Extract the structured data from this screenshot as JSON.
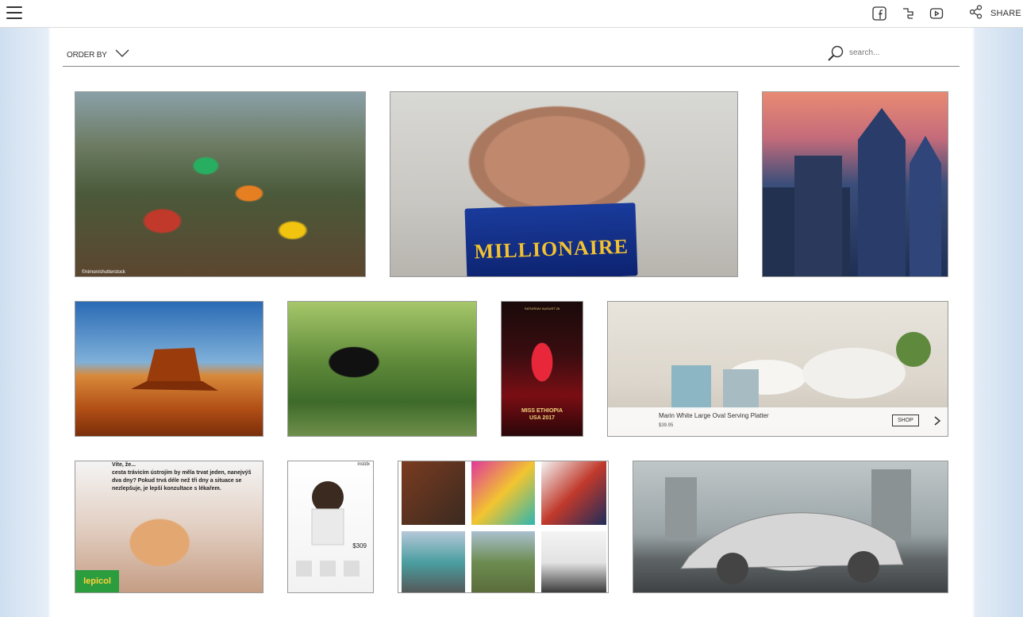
{
  "header": {
    "menu_icon": "hamburger-menu-icon",
    "social": [
      {
        "name": "facebook-icon",
        "label": "Facebook"
      },
      {
        "name": "twitter-icon",
        "label": "Twitter"
      },
      {
        "name": "youtube-icon",
        "label": "YouTube"
      }
    ],
    "share_label": "SHARE",
    "share_icon": "share-icon"
  },
  "toolbar": {
    "order_by_label": "ORDER BY",
    "search_placeholder": "search..."
  },
  "tiles": {
    "millionaire": {
      "text": "MILLIONAIRE"
    },
    "market": {
      "credit": "©nimon/shutterstock"
    },
    "poster": {
      "title": "MISS ETHIOPIA",
      "subtitle": "USA 2017",
      "top": "SATURDAY AUGUST 26"
    },
    "dishes": {
      "product_name": "Marin White Large Oval Serving Platter",
      "price": "$39.95",
      "shop_label": "SHOP"
    },
    "lepicol": {
      "text": "Víte, že...\ncesta trávicím ústrojím by měla trvat jeden, nanejvýš dva dny? Pokud trvá déle než tři dny a situace se nezlepšuje, je lepší konzultace s lékařem.",
      "logo": "lepicol"
    },
    "magazine": {
      "brand": "instdx",
      "price": "$309"
    }
  },
  "colors": {
    "accent": "#333333",
    "divider": "#888888",
    "side_gradient": "#cfdff0"
  }
}
